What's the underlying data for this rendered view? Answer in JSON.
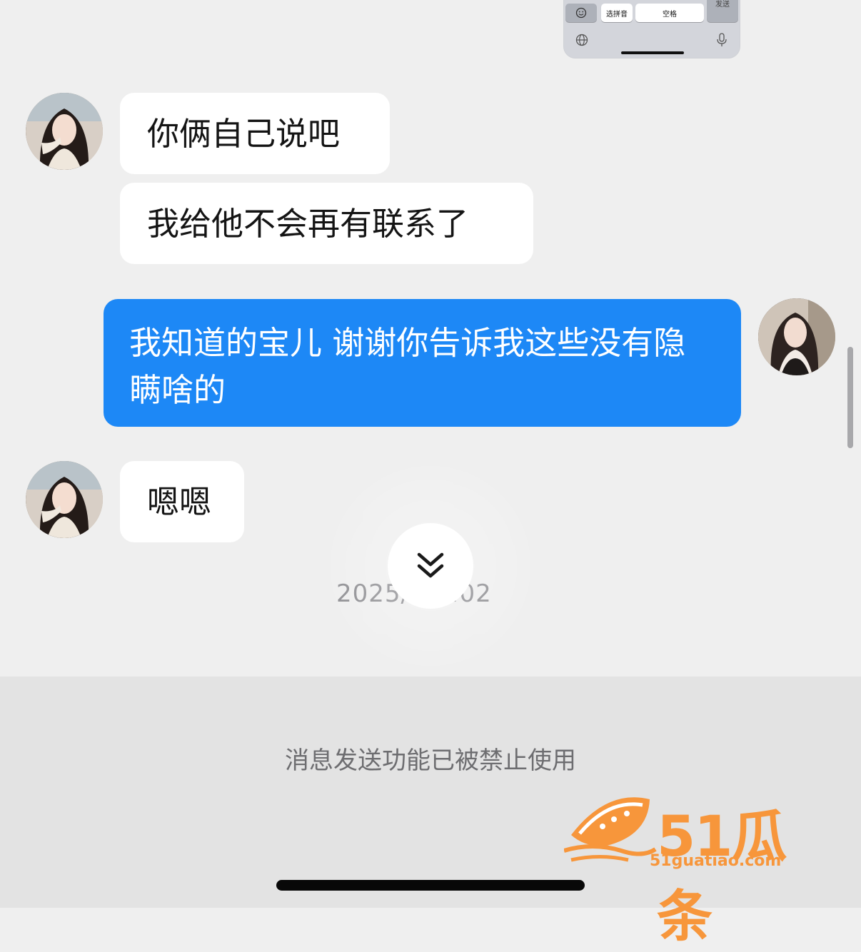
{
  "keyboard_preview": {
    "pinyin_key": "选拼音",
    "space_key": "空格",
    "send_key": "发送"
  },
  "messages": [
    {
      "from": "other",
      "text": "你俩自己说吧"
    },
    {
      "from": "other",
      "text": "我给他不会再有联系了"
    },
    {
      "from": "me",
      "text": "我知道的宝儿 谢谢你告诉我这些没有隐瞒啥的"
    },
    {
      "from": "other",
      "text": "嗯嗯"
    }
  ],
  "timestamp": "2025/  11:02",
  "bottom_bar": {
    "disabled_notice": "消息发送功能已被禁止使用"
  },
  "watermark": {
    "brand": "51瓜条",
    "url": "51guatiao.com"
  },
  "colors": {
    "outgoing_bubble": "#1d88f6",
    "incoming_bubble": "#ffffff",
    "background": "#efefef",
    "watermark": "#f7963b"
  }
}
